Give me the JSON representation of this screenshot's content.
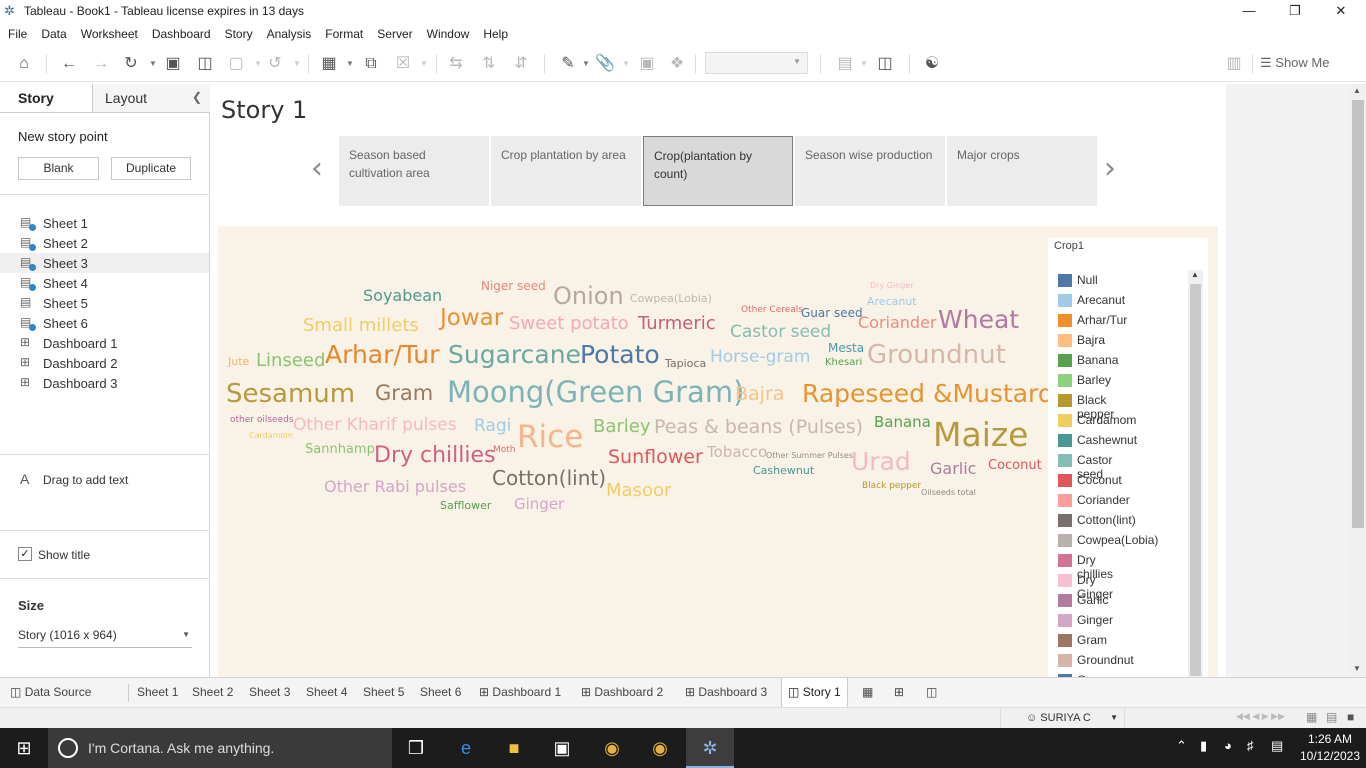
{
  "window": {
    "title": "Tableau - Book1 - Tableau license expires in 13 days"
  },
  "menu": [
    "File",
    "Data",
    "Worksheet",
    "Dashboard",
    "Story",
    "Analysis",
    "Format",
    "Server",
    "Window",
    "Help"
  ],
  "toolbar": {
    "show_me": "Show Me"
  },
  "left_pane": {
    "tab_story": "Story",
    "tab_layout": "Layout",
    "new_story_point": "New story point",
    "blank": "Blank",
    "duplicate": "Duplicate",
    "sheets": [
      "Sheet 1",
      "Sheet 2",
      "Sheet 3",
      "Sheet 4",
      "Sheet 5",
      "Sheet 6",
      "Dashboard 1",
      "Dashboard 2",
      "Dashboard 3"
    ],
    "drag_text": "Drag to add text",
    "show_title": "Show title",
    "size_heading": "Size",
    "size_value": "Story (1016 x 964)"
  },
  "story": {
    "title": "Story 1",
    "points": [
      "Season based cultivation area",
      "Crop plantation by area",
      "Crop(plantation by count)",
      "Season wise production",
      "Major crops"
    ],
    "selected_point": 2
  },
  "wordcloud": [
    {
      "t": "Soyabean",
      "c": "#4e9a8c"
    },
    {
      "t": "Niger seed",
      "c": "#e8867a"
    },
    {
      "t": "Onion",
      "c": "#b5a89e"
    },
    {
      "t": "Cowpea(Lobia)",
      "c": "#c0b6ad"
    },
    {
      "t": "Dry Ginger",
      "c": "#f5b8c8"
    },
    {
      "t": "Arecanut",
      "c": "#9ec9e8"
    },
    {
      "t": "Other Cereals",
      "c": "#e06c6c"
    },
    {
      "t": "Guar seed",
      "c": "#4e79a7"
    },
    {
      "t": "Small millets",
      "c": "#f1ce63"
    },
    {
      "t": "Jowar",
      "c": "#e89234"
    },
    {
      "t": "Sweet potato",
      "c": "#f5a8b8"
    },
    {
      "t": "Turmeric",
      "c": "#c2607a"
    },
    {
      "t": "Castor seed",
      "c": "#86bcb6"
    },
    {
      "t": "Coriander",
      "c": "#f08a84"
    },
    {
      "t": "Wheat",
      "c": "#b07aa1"
    },
    {
      "t": "Jute",
      "c": "#f5b56a"
    },
    {
      "t": "Linseed",
      "c": "#8cc470"
    },
    {
      "t": "Arhar/Tur",
      "c": "#e8862c"
    },
    {
      "t": "Sugarcane",
      "c": "#6aa8a2"
    },
    {
      "t": "Potato",
      "c": "#4e79a7"
    },
    {
      "t": "Tapioca",
      "c": "#79706e"
    },
    {
      "t": "Horse-gram",
      "c": "#a0cbe8"
    },
    {
      "t": "Mesta",
      "c": "#4e9aa8"
    },
    {
      "t": "Khesari",
      "c": "#59a14f"
    },
    {
      "t": "Groundnut",
      "c": "#d4b8aa"
    },
    {
      "t": "Sesamum",
      "c": "#b89a3e"
    },
    {
      "t": "Gram",
      "c": "#9a7a5e"
    },
    {
      "t": "Moong(Green Gram)",
      "c": "#7ab4b8"
    },
    {
      "t": "Bajra",
      "c": "#f6c48a"
    },
    {
      "t": "Rapeseed &Mustard",
      "c": "#e8942e"
    },
    {
      "t": "other oilseeds",
      "c": "#b9669a"
    },
    {
      "t": "Cardamom",
      "c": "#f1ce63"
    },
    {
      "t": "Other Kharif pulses",
      "c": "#f5b8c8"
    },
    {
      "t": "Ragi",
      "c": "#a0cbe8"
    },
    {
      "t": "Rice",
      "c": "#f5b58a"
    },
    {
      "t": "Barley",
      "c": "#8cc470"
    },
    {
      "t": "Peas & beans (Pulses)",
      "c": "#c9b6ad"
    },
    {
      "t": "Banana",
      "c": "#59a14f"
    },
    {
      "t": "Maize",
      "c": "#b89a3e"
    },
    {
      "t": "Sannhamp",
      "c": "#8cc470"
    },
    {
      "t": "Dry chillies",
      "c": "#d15f82"
    },
    {
      "t": "Moth",
      "c": "#e06c6c"
    },
    {
      "t": "Sunflower",
      "c": "#e15759"
    },
    {
      "t": "Tobacco",
      "c": "#c9b6ad"
    },
    {
      "t": "Other Summer Pulses",
      "c": "#9a8a80"
    },
    {
      "t": "Urad",
      "c": "#f5b8c8"
    },
    {
      "t": "Garlic",
      "c": "#b07aa1"
    },
    {
      "t": "Coconut",
      "c": "#e15759"
    },
    {
      "t": "Cashewnut",
      "c": "#499894"
    },
    {
      "t": "Cotton(lint)",
      "c": "#79706e"
    },
    {
      "t": "Other Rabi pulses",
      "c": "#d4a6c8"
    },
    {
      "t": "Masoor",
      "c": "#f1ce63"
    },
    {
      "t": "Black pepper",
      "c": "#b6992d"
    },
    {
      "t": "Oilseeds total",
      "c": "#8a8a8a"
    },
    {
      "t": "Safflower",
      "c": "#59a14f"
    },
    {
      "t": "Ginger",
      "c": "#d4a6c8"
    }
  ],
  "legend": {
    "title": "Crop1",
    "items": [
      {
        "name": "Null",
        "color": "#4e79a7"
      },
      {
        "name": "Arecanut",
        "color": "#a0cbe8"
      },
      {
        "name": "Arhar/Tur",
        "color": "#f28e2b"
      },
      {
        "name": "Bajra",
        "color": "#ffbe7d"
      },
      {
        "name": "Banana",
        "color": "#59a14f"
      },
      {
        "name": "Barley",
        "color": "#8cd17d"
      },
      {
        "name": "Black pepper",
        "color": "#b6992d"
      },
      {
        "name": "Cardamom",
        "color": "#f1ce63"
      },
      {
        "name": "Cashewnut",
        "color": "#499894"
      },
      {
        "name": "Castor seed",
        "color": "#86bcb6"
      },
      {
        "name": "Coconut",
        "color": "#e15759"
      },
      {
        "name": "Coriander",
        "color": "#ff9d9a"
      },
      {
        "name": "Cotton(lint)",
        "color": "#79706e"
      },
      {
        "name": "Cowpea(Lobia)",
        "color": "#bab0ac"
      },
      {
        "name": "Dry chillies",
        "color": "#d37295"
      },
      {
        "name": "Dry Ginger",
        "color": "#fabfd2"
      },
      {
        "name": "Garlic",
        "color": "#b07aa1"
      },
      {
        "name": "Ginger",
        "color": "#d4a6c8"
      },
      {
        "name": "Gram",
        "color": "#9d7660"
      },
      {
        "name": "Groundnut",
        "color": "#d7b5a6"
      },
      {
        "name": "Guar seed",
        "color": "#4e79a7"
      }
    ]
  },
  "sheet_tabs": [
    "Data Source",
    "Sheet 1",
    "Sheet 2",
    "Sheet 3",
    "Sheet 4",
    "Sheet 5",
    "Sheet 6",
    "Dashboard 1",
    "Dashboard 2",
    "Dashboard 3",
    "Story 1"
  ],
  "status": {
    "user": "SURIYA C"
  },
  "taskbar": {
    "cortana": "I'm Cortana. Ask me anything.",
    "time": "1:26 AM",
    "date": "10/12/2023"
  }
}
